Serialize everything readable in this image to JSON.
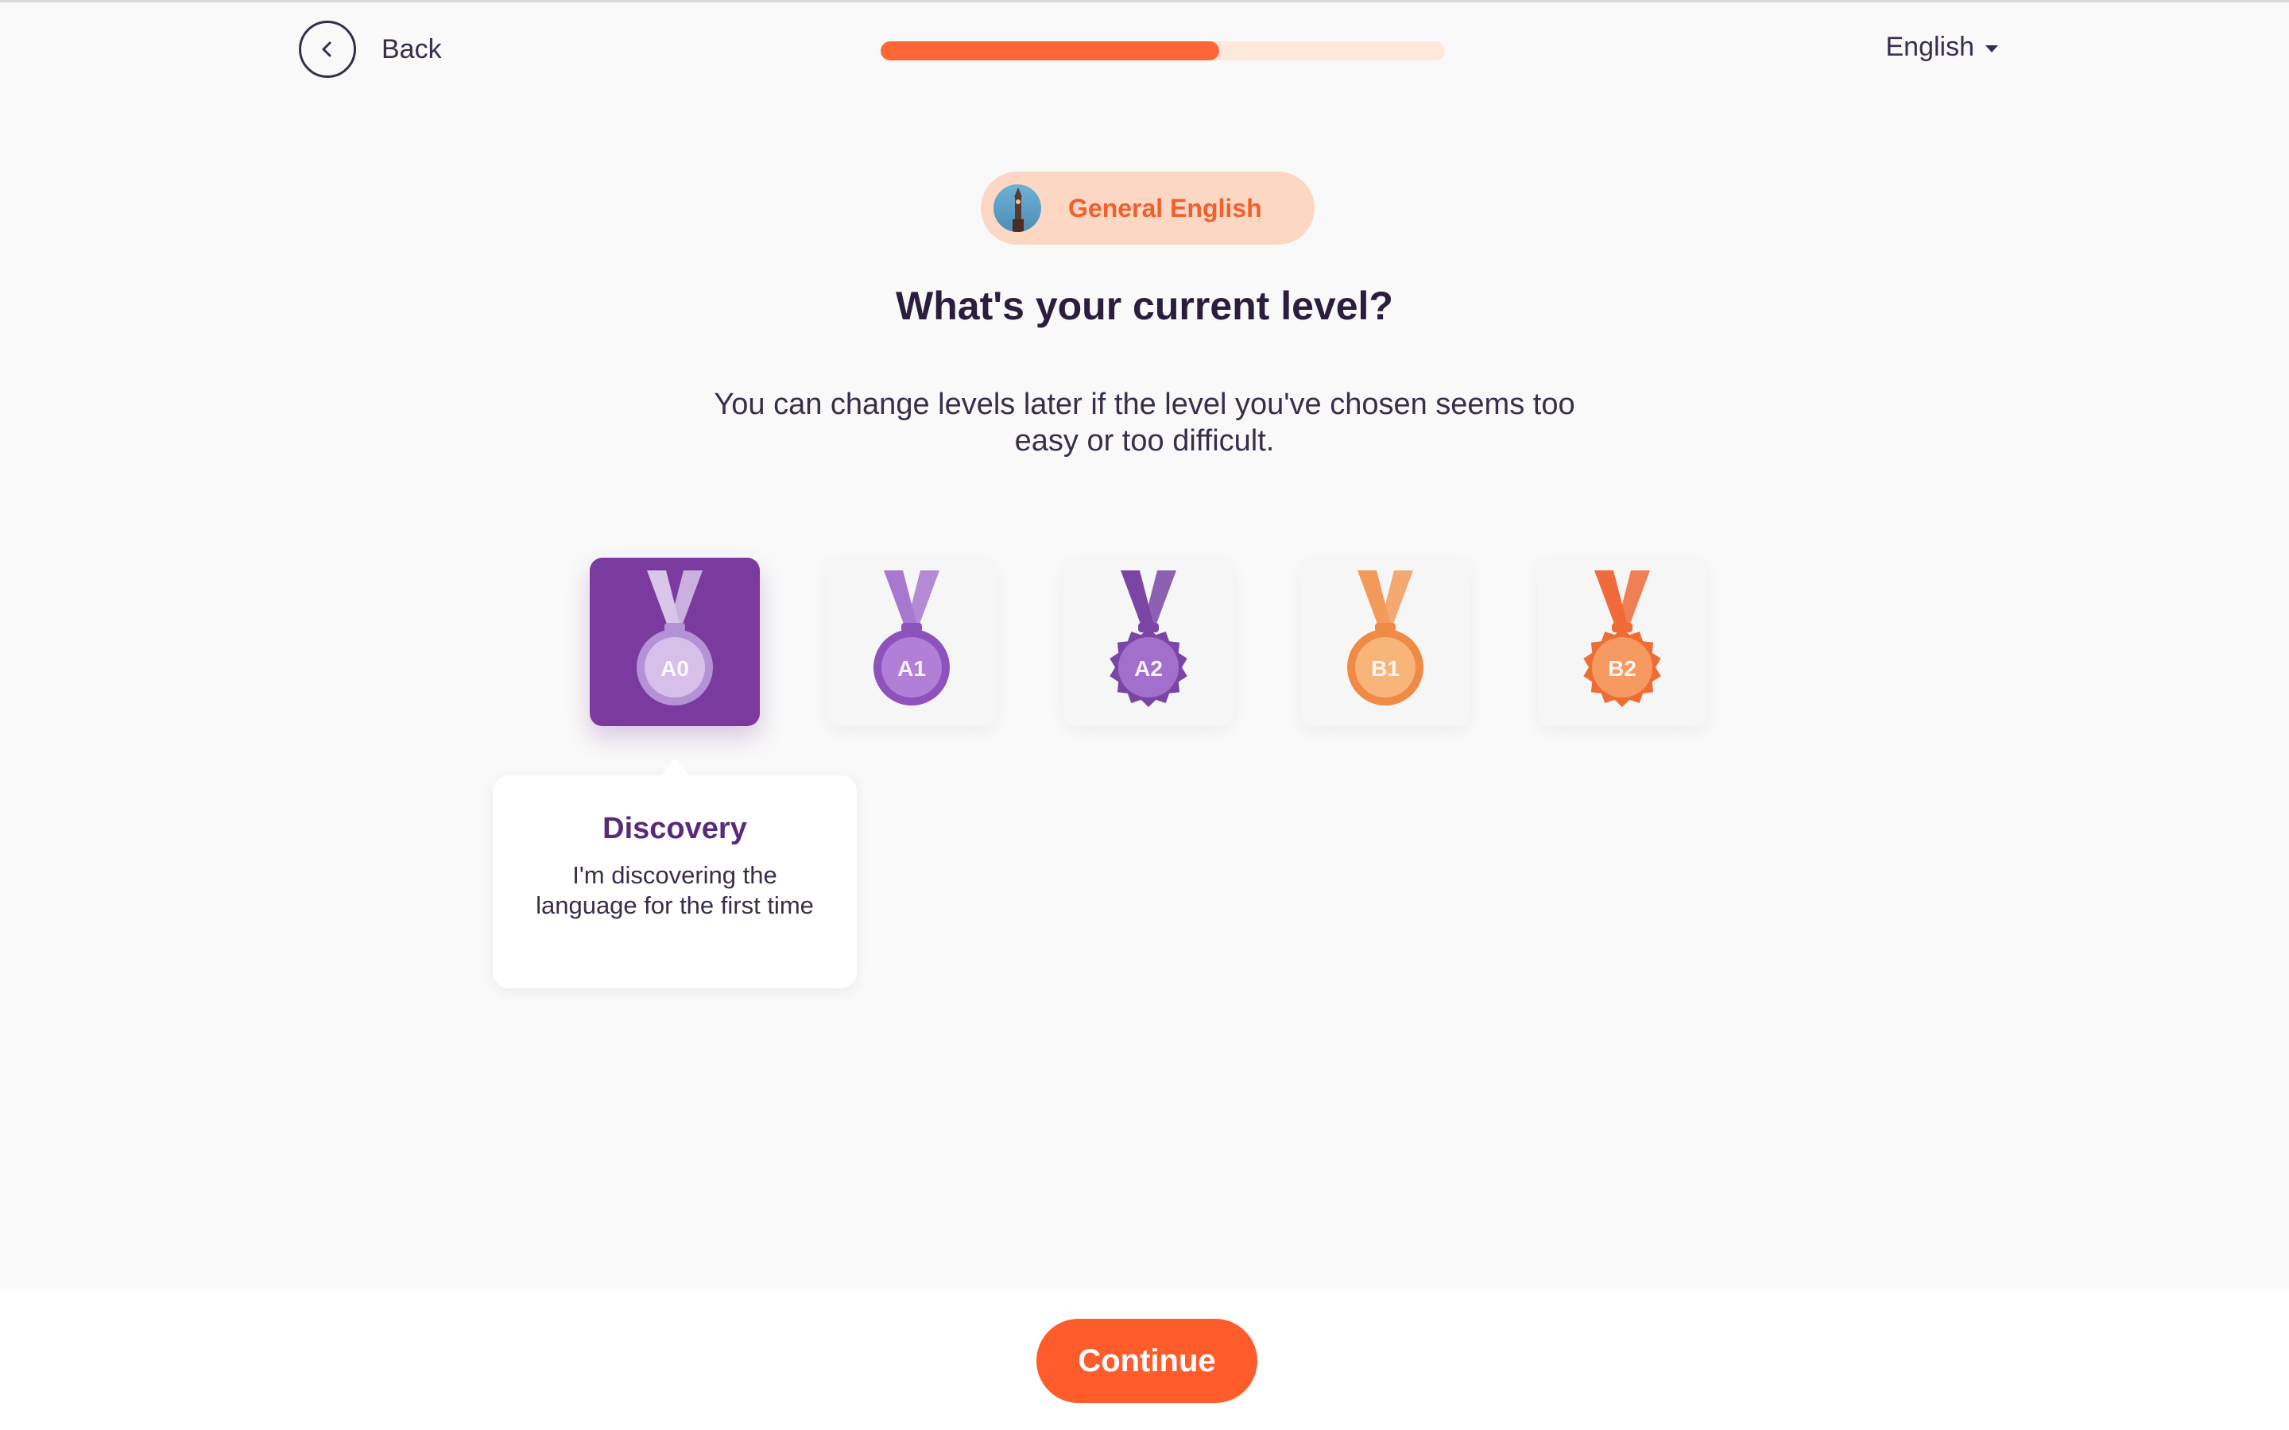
{
  "header": {
    "back_label": "Back",
    "progress_fraction": 0.6,
    "language": "English"
  },
  "course": {
    "name": "General English"
  },
  "page": {
    "title": "What's your current level?",
    "subtitle": "You can change levels later if the level you've chosen seems too easy or too difficult."
  },
  "levels": [
    {
      "code": "A0",
      "icon": "medal-a0-icon",
      "selected": true,
      "ribbon": "#d9c6ea",
      "medal": "#d6c0ea",
      "rim": "#b592d6",
      "style": "round"
    },
    {
      "code": "A1",
      "icon": "medal-a1-icon",
      "selected": false,
      "ribbon": "#a877cf",
      "medal": "#b17fd8",
      "rim": "#8e52bd",
      "style": "round"
    },
    {
      "code": "A2",
      "icon": "medal-a2-icon",
      "selected": false,
      "ribbon": "#7b45a6",
      "medal": "#a36fcc",
      "rim": "#7b45a6",
      "style": "gear"
    },
    {
      "code": "B1",
      "icon": "medal-b1-icon",
      "selected": false,
      "ribbon": "#f39a5b",
      "medal": "#f7b57a",
      "rim": "#f08a45",
      "style": "round"
    },
    {
      "code": "B2",
      "icon": "medal-b2-icon",
      "selected": false,
      "ribbon": "#f06a3a",
      "medal": "#f79a62",
      "rim": "#ee6d34",
      "style": "gear"
    }
  ],
  "tooltip": {
    "title": "Discovery",
    "description": "I'm discovering the language for the first time"
  },
  "footer": {
    "continue_label": "Continue"
  },
  "colors": {
    "accent": "#ff5c2b",
    "selected": "#7a3a9e",
    "text": "#2b1d3d"
  }
}
